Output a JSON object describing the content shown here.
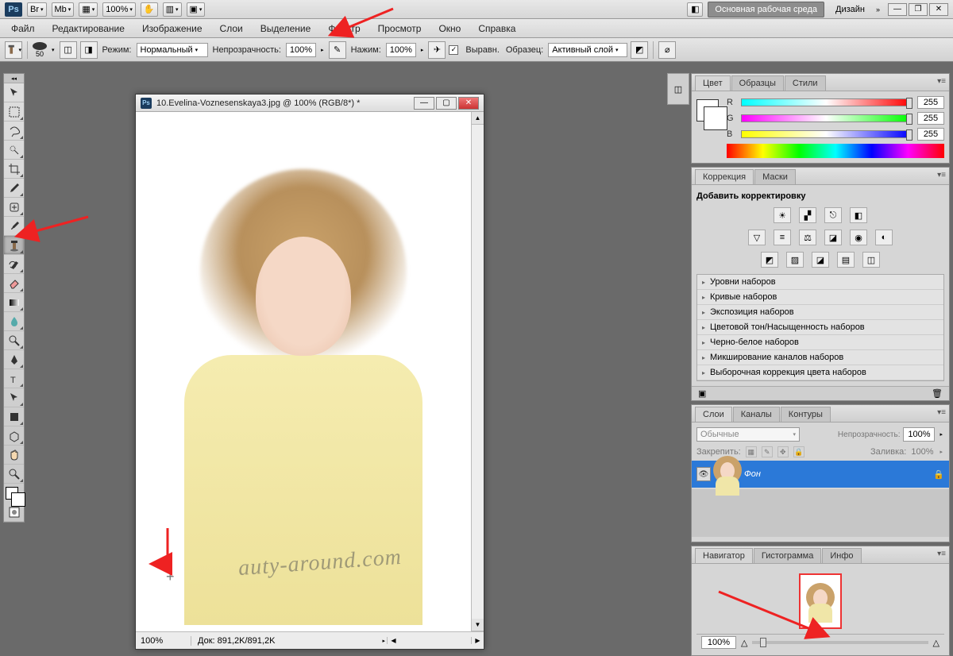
{
  "appbar": {
    "logo": "Ps",
    "zoom": "100%",
    "workspace_main": "Основная рабочая среда",
    "workspace_design": "Дизайн"
  },
  "menubar": [
    "Файл",
    "Редактирование",
    "Изображение",
    "Слои",
    "Выделение",
    "Фильтр",
    "Просмотр",
    "Окно",
    "Справка"
  ],
  "optionsbar": {
    "brush_size": "50",
    "mode_label": "Режим:",
    "mode_value": "Нормальный",
    "opacity_label": "Непрозрачность:",
    "opacity_value": "100%",
    "flow_label": "Нажим:",
    "flow_value": "100%",
    "aligned_label": "Выравн.",
    "sample_label": "Образец:",
    "sample_value": "Активный слой"
  },
  "document": {
    "title": "10.Evelina-Voznesenskaya3.jpg @ 100% (RGB/8*) *",
    "status_zoom": "100%",
    "status_doc": "Док: 891,2K/891,2K",
    "watermark": "auty-around.com"
  },
  "panels": {
    "color": {
      "tabs": [
        "Цвет",
        "Образцы",
        "Стили"
      ],
      "channels": [
        {
          "label": "R",
          "value": "255"
        },
        {
          "label": "G",
          "value": "255"
        },
        {
          "label": "B",
          "value": "255"
        }
      ]
    },
    "adjustments": {
      "tabs": [
        "Коррекция",
        "Маски"
      ],
      "heading": "Добавить корректировку",
      "presets": [
        "Уровни наборов",
        "Кривые наборов",
        "Экспозиция наборов",
        "Цветовой тон/Насыщенность наборов",
        "Черно-белое наборов",
        "Микширование каналов наборов",
        "Выборочная коррекция цвета наборов"
      ]
    },
    "layers": {
      "tabs": [
        "Слои",
        "Каналы",
        "Контуры"
      ],
      "blend_mode": "Обычные",
      "opacity_label": "Непрозрачность:",
      "opacity_value": "100%",
      "lock_label": "Закрепить:",
      "fill_label": "Заливка:",
      "fill_value": "100%",
      "layer_name": "Фон"
    },
    "navigator": {
      "tabs": [
        "Навигатор",
        "Гистограмма",
        "Инфо"
      ],
      "zoom": "100%"
    }
  }
}
